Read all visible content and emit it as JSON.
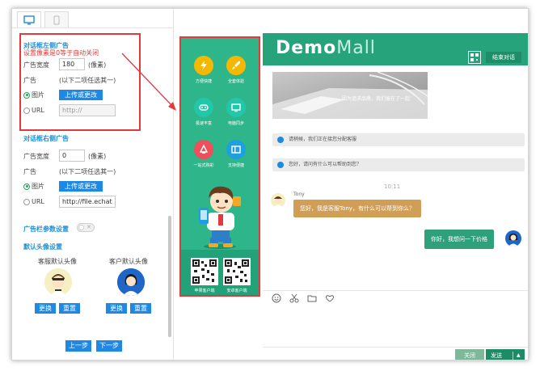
{
  "left_panel": {
    "left_ad": {
      "title": "对话框左侧广告",
      "warning": "设置像素是0等于自动关闭",
      "width_label": "广告宽度",
      "width_value": "180",
      "width_unit": "(像素)",
      "ad_label": "广告",
      "ad_hint": "(以下二项任选其一)",
      "image_option": "图片",
      "upload_label": "上传或更改",
      "url_option": "URL",
      "url_placeholder": "http://"
    },
    "right_ad": {
      "title": "对话框右侧广告",
      "width_label": "广告宽度",
      "width_value": "0",
      "width_unit": "(像素)",
      "ad_label": "广告",
      "ad_hint": "(以下二项任选其一)",
      "image_option": "图片",
      "upload_label": "上传或更改",
      "url_option": "URL",
      "url_value": "http://file.echat"
    },
    "ad_params_label": "广告栏参数设置",
    "avatar_section": {
      "title": "默认头像设置",
      "agent_label": "客服默认头像",
      "customer_label": "客户默认头像",
      "replace_label": "更换",
      "reset_label": "重置"
    },
    "prev_label": "上一步",
    "next_label": "下一步"
  },
  "ad_column": {
    "features": [
      {
        "label": "方便快捷",
        "icon": "lightning-icon",
        "color": "#f5b800"
      },
      {
        "label": "全套体验",
        "icon": "rocket-icon",
        "color": "#f5b800"
      },
      {
        "label": "极速丰富",
        "icon": "gamepad-icon",
        "color": "#21c7a8"
      },
      {
        "label": "电脑同步",
        "icon": "monitor-icon",
        "color": "#21c7a8"
      },
      {
        "label": "一站式购彩",
        "icon": "lottery-icon",
        "color": "#ef4f5a"
      },
      {
        "label": "支持便捷",
        "icon": "cards-icon",
        "color": "#1e9fe0"
      }
    ],
    "qr_labels": [
      "苹果客户端",
      "安卓客户端"
    ]
  },
  "chat": {
    "logo_bold": "Dem",
    "logo_o": "o",
    "logo_thin": "Mall",
    "end_chat_label": "结束对话",
    "banner_text": "因为追求品质，我们留在了一起",
    "sys_messages": [
      "请稍候，我们正在接您分配客服",
      "您好，请问有什么可以帮助到您？"
    ],
    "time": "10:11",
    "agent_name": "Tony",
    "agent_message": "您好，我是客服Tony，有什么可以帮到你么？",
    "user_message": "你好，我想问一下价格",
    "close_label": "关闭",
    "send_label": "发送"
  },
  "colors": {
    "accent_green": "#27a37b",
    "highlight_red": "#e0393e",
    "link_blue": "#1f8fd6",
    "button_blue": "#1e88e5"
  }
}
